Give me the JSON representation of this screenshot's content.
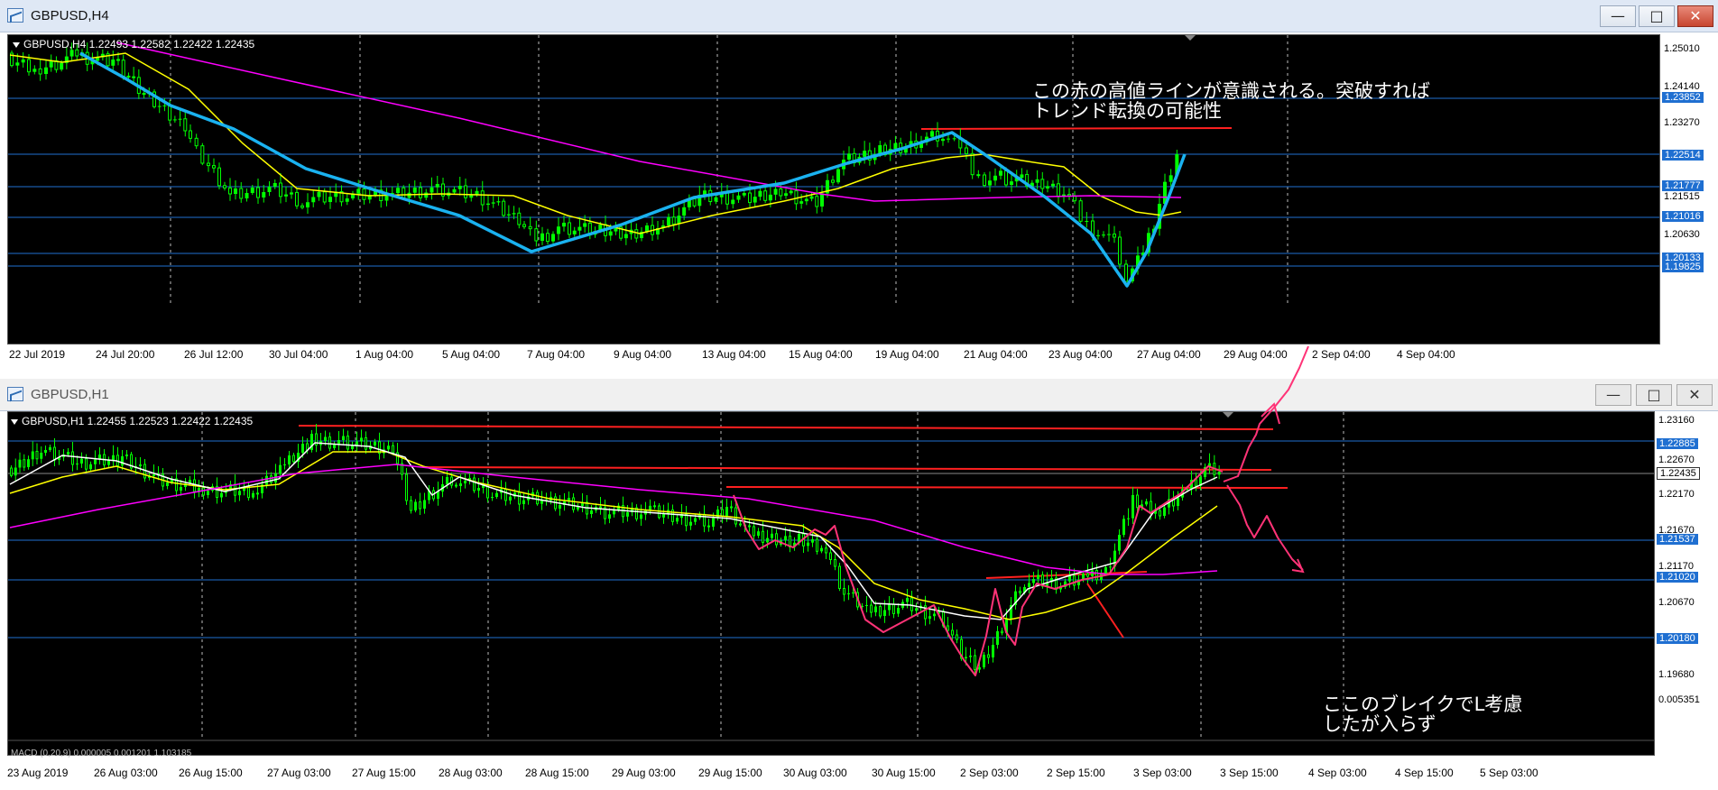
{
  "top": {
    "title": "GBPUSD,H4",
    "info": "GBPUSD,H4  1.22493 1.22582 1.22422 1.22435",
    "annotation": "この赤の高値ラインが意識される。突破すれば\nトレンド転換の可能性",
    "prices": [
      {
        "label": "1.25010"
      },
      {
        "label": "1.24140"
      },
      {
        "label": "1.23852",
        "hl": true
      },
      {
        "label": "1.23270"
      },
      {
        "label": "1.22514",
        "hl": true
      },
      {
        "label": "1.21777",
        "hl": true
      },
      {
        "label": "1.21515"
      },
      {
        "label": "1.21016",
        "hl": true
      },
      {
        "label": "1.20630"
      },
      {
        "label": "1.20133",
        "hl": true
      },
      {
        "label": "1.19825",
        "hl": true
      }
    ],
    "times": [
      "22 Jul 2019",
      "24 Jul 20:00",
      "26 Jul 12:00",
      "30 Jul 04:00",
      "1 Aug 04:00",
      "5 Aug 04:00",
      "7 Aug 04:00",
      "9 Aug 04:00",
      "13 Aug 04:00",
      "15 Aug 04:00",
      "19 Aug 04:00",
      "21 Aug 04:00",
      "23 Aug 04:00",
      "27 Aug 04:00",
      "29 Aug 04:00",
      "2 Sep 04:00",
      "4 Sep 04:00"
    ]
  },
  "bottom": {
    "title": "GBPUSD,H1",
    "info": "GBPUSD,H1  1.22455 1.22523 1.22422 1.22435",
    "macd": "MACD (0,20,9) 0.000005 0.001201 1.103185",
    "annotation": "ここのブレイクでL考慮\nしたが入らず",
    "prices": [
      {
        "label": "1.23160"
      },
      {
        "label": "1.22885",
        "hl": true
      },
      {
        "label": "1.22670"
      },
      {
        "label": "1.22435",
        "hl": true,
        "white": true
      },
      {
        "label": "1.22170"
      },
      {
        "label": "1.21670"
      },
      {
        "label": "1.21537",
        "hl": true
      },
      {
        "label": "1.21170"
      },
      {
        "label": "1.21020",
        "hl": true
      },
      {
        "label": "1.20670"
      },
      {
        "label": "1.20180",
        "hl": true
      },
      {
        "label": "1.19680"
      },
      {
        "label": "0.005351"
      }
    ],
    "times": [
      "23 Aug 2019",
      "26 Aug 03:00",
      "26 Aug 15:00",
      "27 Aug 03:00",
      "27 Aug 15:00",
      "28 Aug 03:00",
      "28 Aug 15:00",
      "29 Aug 03:00",
      "29 Aug 15:00",
      "30 Aug 03:00",
      "30 Aug 15:00",
      "2 Sep 03:00",
      "2 Sep 15:00",
      "3 Sep 03:00",
      "3 Sep 15:00",
      "4 Sep 03:00",
      "4 Sep 15:00",
      "5 Sep 03:00"
    ]
  },
  "colors": {
    "candle": "#00ff00",
    "ma_fast": "#ffffff",
    "ma_mid": "#ffff00",
    "ma_slow": "#ff00ff",
    "trend": "#1ab2f0",
    "hline": "#1f6fd1",
    "redline": "#ff2020",
    "pen": "#ff3377"
  },
  "icons": {
    "minimize": "minimize-icon",
    "maximize": "maximize-icon",
    "close": "close-icon"
  }
}
